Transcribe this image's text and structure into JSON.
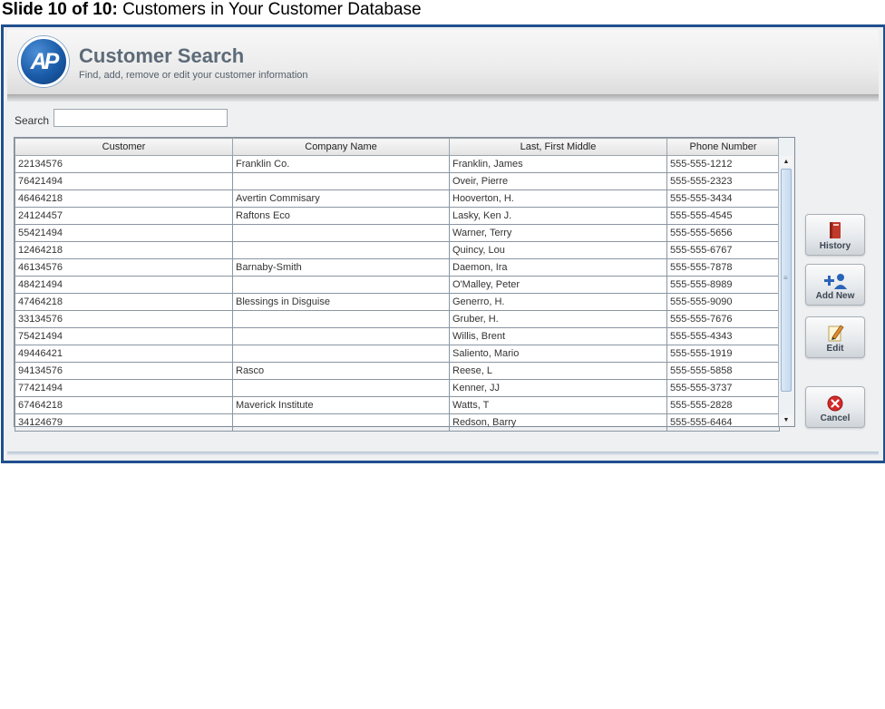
{
  "slide": {
    "prefix": "Slide 10 of 10:",
    "title": "Customers in Your Customer Database"
  },
  "app": {
    "logo_text": "AP",
    "title": "Customer Search",
    "subtitle": "Find, add, remove or edit your customer information"
  },
  "search": {
    "label": "Search",
    "value": ""
  },
  "table": {
    "columns": [
      "Customer",
      "Company Name",
      "Last, First Middle",
      "Phone Number"
    ],
    "rows": [
      [
        "22134576",
        "Franklin Co.",
        "Franklin, James",
        "555-555-1212"
      ],
      [
        "76421494",
        "",
        "Oveir, Pierre",
        "555-555-2323"
      ],
      [
        "46464218",
        "Avertin Commisary",
        "Hooverton, H.",
        "555-555-3434"
      ],
      [
        "24124457",
        "Raftons Eco",
        "Lasky, Ken J.",
        "555-555-4545"
      ],
      [
        "55421494",
        "",
        "Warner, Terry",
        "555-555-5656"
      ],
      [
        "12464218",
        "",
        "Quincy, Lou",
        "555-555-6767"
      ],
      [
        "46134576",
        "Barnaby-Smith",
        "Daemon, Ira",
        "555-555-7878"
      ],
      [
        "48421494",
        "",
        "O'Malley, Peter",
        "555-555-8989"
      ],
      [
        "47464218",
        "Blessings in Disguise",
        "Generro, H.",
        "555-555-9090"
      ],
      [
        "33134576",
        "",
        "Gruber, H.",
        "555-555-7676"
      ],
      [
        "75421494",
        "",
        "Willis, Brent",
        "555-555-4343"
      ],
      [
        "49446421",
        "",
        "Saliento, Mario",
        "555-555-1919"
      ],
      [
        "94134576",
        "Rasco",
        "Reese, L",
        "555-555-5858"
      ],
      [
        "77421494",
        "",
        "Kenner, JJ",
        "555-555-3737"
      ],
      [
        "67464218",
        "Maverick Institute",
        "Watts, T",
        "555-555-2828"
      ],
      [
        "34124679",
        "",
        "Redson, Barry",
        "555-555-6464"
      ]
    ]
  },
  "buttons": {
    "history": "History",
    "add_new": "Add New",
    "edit": "Edit",
    "cancel": "Cancel"
  },
  "colors": {
    "frame_border": "#1f4f8e",
    "logo_blue": "#1a5ba8",
    "cancel_red": "#d42a2a"
  }
}
